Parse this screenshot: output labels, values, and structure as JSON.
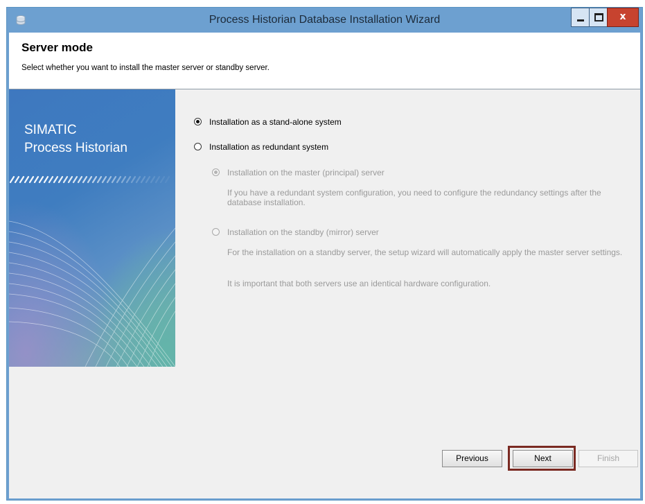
{
  "window": {
    "title": "Process Historian Database Installation Wizard"
  },
  "header": {
    "title": "Server mode",
    "subtitle": "Select whether you want to install the master server or standby server."
  },
  "banner": {
    "line1": "SIMATIC",
    "line2": "Process Historian"
  },
  "options": {
    "standalone": {
      "label": "Installation as a stand-alone system",
      "selected": true,
      "enabled": true
    },
    "redundant": {
      "label": "Installation as redundant system",
      "selected": false,
      "enabled": true
    },
    "master": {
      "label": "Installation on the master (principal) server",
      "selected": true,
      "enabled": false,
      "description": "If you have a redundant system configuration, you need to configure the redundancy settings after the database installation."
    },
    "standby": {
      "label": "Installation on the standby (mirror) server",
      "selected": false,
      "enabled": false,
      "description1": "For the installation on a standby server, the setup wizard will automatically apply the master server settings.",
      "description2": "It is important that both servers use an identical hardware configuration."
    }
  },
  "buttons": {
    "previous": "Previous",
    "next": "Next",
    "finish": "Finish"
  },
  "colors": {
    "titlebar": "#6da0d0",
    "highlight": "#7a2a22",
    "close": "#c7432f"
  }
}
